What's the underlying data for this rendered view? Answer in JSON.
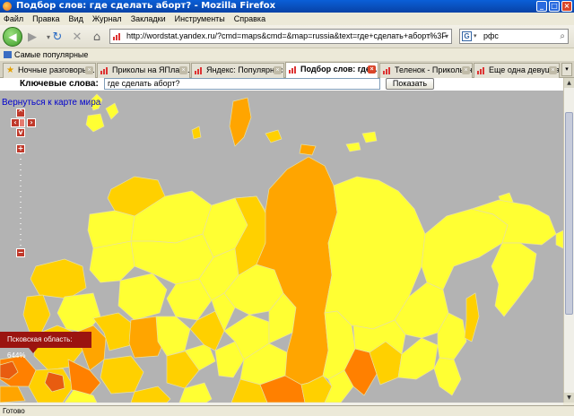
{
  "window": {
    "title": "Подбор слов: где сделать аборт? - Mozilla Firefox"
  },
  "menu": [
    "Файл",
    "Правка",
    "Вид",
    "Журнал",
    "Закладки",
    "Инструменты",
    "Справка"
  ],
  "nav": {
    "url": "http://wordstat.yandex.ru/?cmd=maps&cmd=&map=russia&text=где+сделать+аборт%3F",
    "search_value": "рфс"
  },
  "bookmarks": {
    "label": "Самые популярные"
  },
  "tabs": [
    {
      "label": "Ночные разговоры...",
      "active": false
    },
    {
      "label": "Приколы на ЯПлака...",
      "active": false
    },
    {
      "label": "Яндекс: Популярнос...",
      "active": false
    },
    {
      "label": "Подбор слов: где...",
      "active": true
    },
    {
      "label": "Теленок - Приколы н...",
      "active": false
    },
    {
      "label": "Еще одна девушка н...",
      "active": false
    }
  ],
  "page": {
    "keywords_label": "Ключевые слова:",
    "keywords_value": "где сделать аборт?",
    "show_button": "Показать",
    "back_link": "Вернуться к карте мира",
    "tooltip": "Псковская область: 644%"
  },
  "colors": {
    "level_1": "#ffff33",
    "level_2": "#ffd000",
    "level_3": "#ffa500",
    "level_4": "#ff8000",
    "level_5": "#e85c10",
    "water": "#b3b3b3",
    "tooltip": "#9b1410"
  },
  "status": {
    "text": "Готово"
  }
}
